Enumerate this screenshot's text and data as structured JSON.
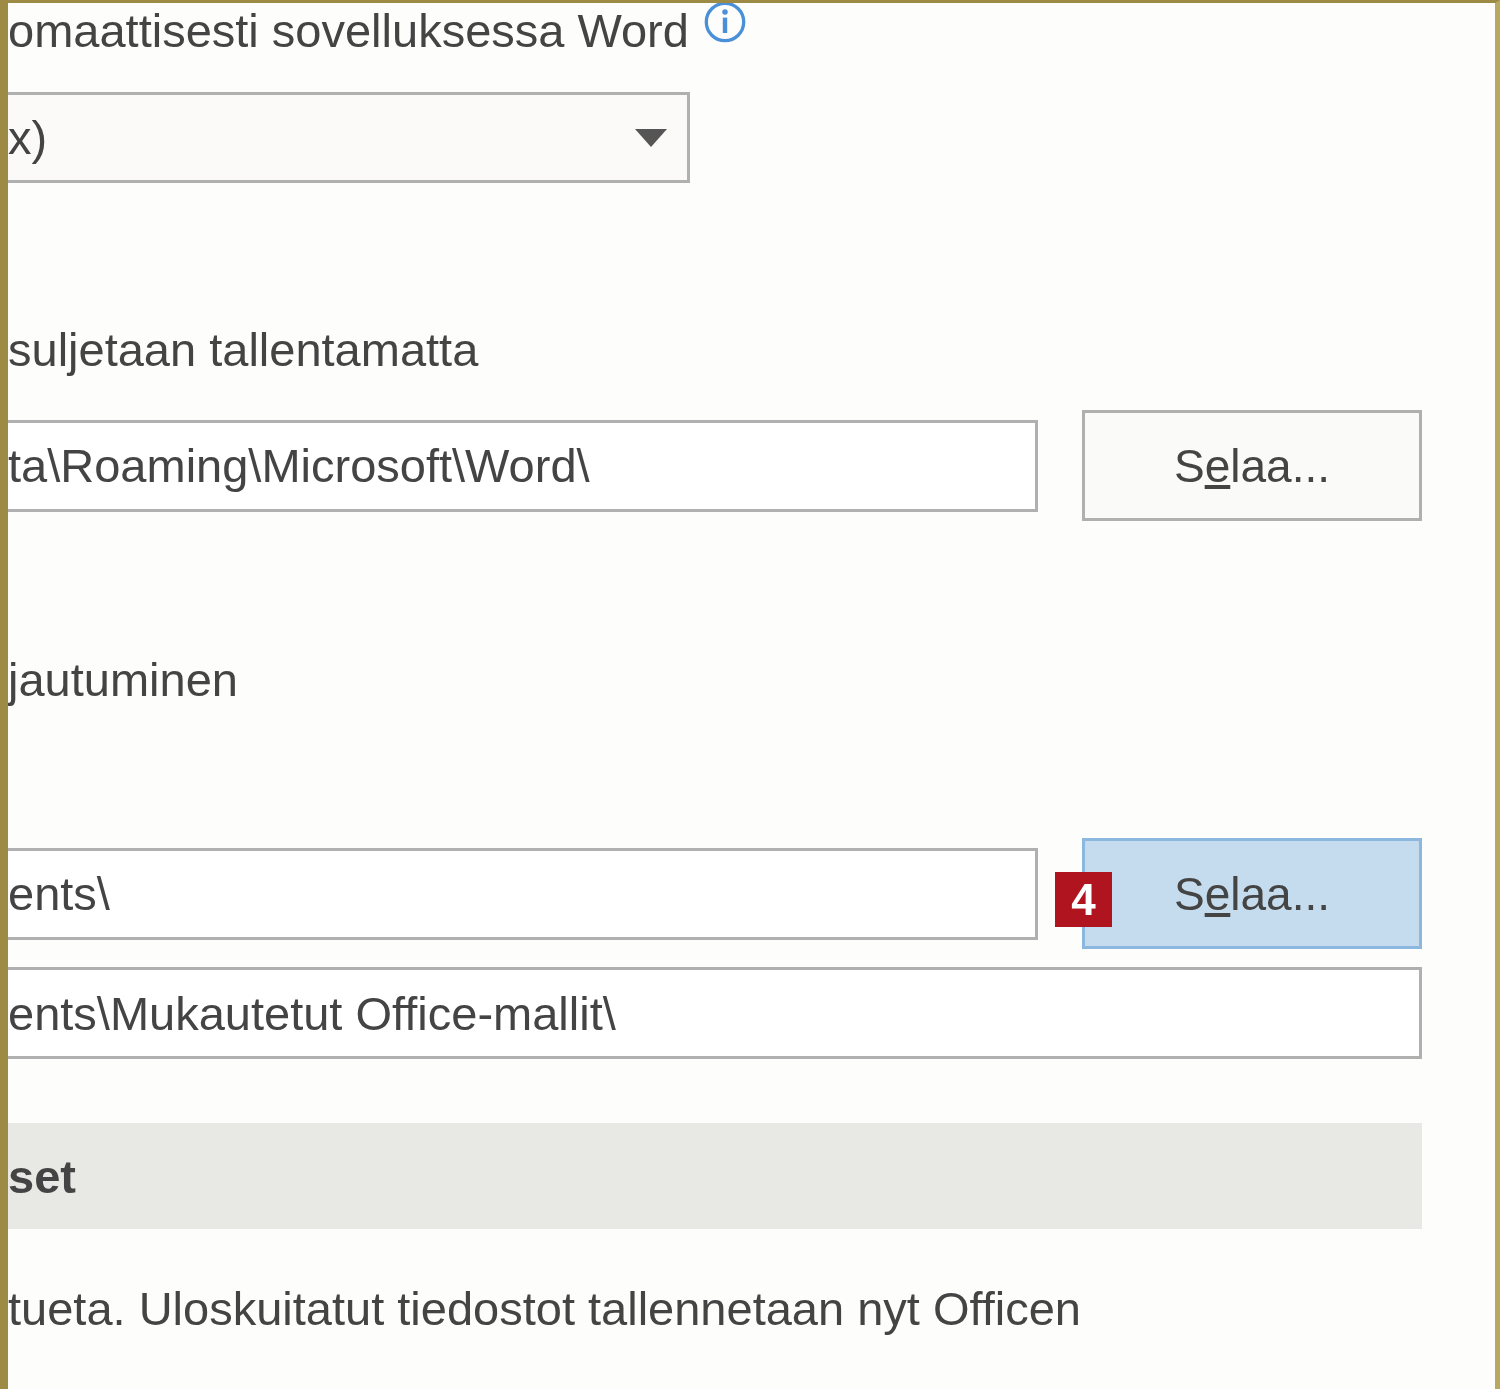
{
  "items": [
    {
      "kind": "label",
      "text": "omaattisesti sovelluksessa Word",
      "info_icon": true
    },
    {
      "kind": "dropdown",
      "value": "x)"
    },
    {
      "kind": "label",
      "text": "suljetaan tallentamatta"
    },
    {
      "kind": "path",
      "value": "ta\\Roaming\\Microsoft\\Word\\",
      "button": {
        "label": "Selaa...",
        "hovered": false
      }
    },
    {
      "kind": "label",
      "text": "jautuminen"
    },
    {
      "kind": "path",
      "value": "ents\\",
      "badge": "4",
      "button": {
        "label": "Selaa...",
        "hovered": true
      }
    },
    {
      "kind": "field",
      "value": "ents\\Mukautetut Office-mallit\\"
    },
    {
      "kind": "section",
      "text": "set"
    },
    {
      "kind": "label",
      "text": "tueta. Uloskuitatut tiedostot tallennetaan nyt Officen"
    }
  ]
}
